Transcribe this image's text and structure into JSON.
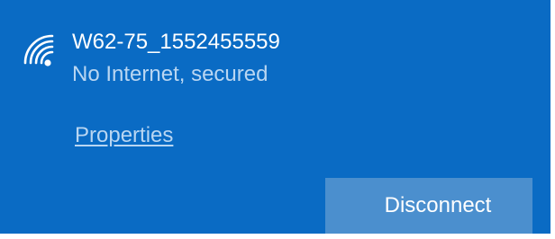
{
  "network": {
    "ssid": "W62-75_1552455559",
    "status": "No Internet, secured",
    "icon": "wifi-icon"
  },
  "actions": {
    "properties_label": "Properties",
    "disconnect_label": "Disconnect"
  },
  "colors": {
    "panel_background": "#0a6bc4",
    "button_background": "#4b8fce",
    "primary_text": "#ffffff",
    "secondary_text": "#b9d6f2"
  }
}
